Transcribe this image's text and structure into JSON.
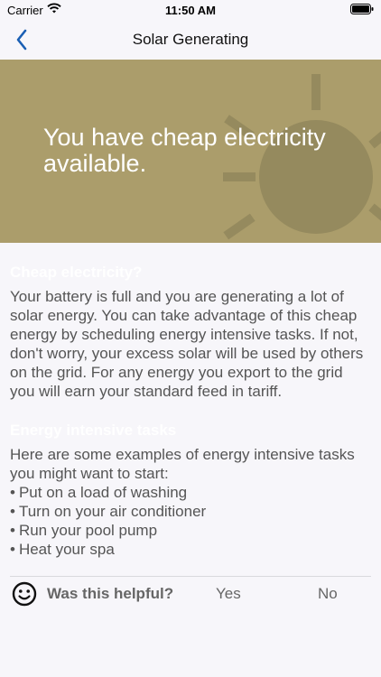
{
  "status_bar": {
    "carrier": "Carrier",
    "time": "11:50 AM"
  },
  "nav": {
    "title": "Solar Generating",
    "accent_color": "#1a5fb4"
  },
  "hero": {
    "headline": "You have cheap electricity available.",
    "background_color": "#ab9d6b"
  },
  "sections": [
    {
      "heading": "Cheap electricity?",
      "body": "Your battery is full and you are generating a lot of solar energy. You can take advantage of this cheap energy by scheduling energy intensive tasks. If not, don't worry, your excess solar will be used by others on the grid. For any energy you export to the grid you will earn your standard feed in tariff."
    },
    {
      "heading": "Energy intensive tasks",
      "body": "Here are some examples of energy intensive tasks you might want to start:",
      "items": [
        "Put on a load of washing",
        "Turn on your air conditioner",
        "Run your pool pump",
        "Heat your spa"
      ]
    }
  ],
  "feedback": {
    "question": "Was this helpful?",
    "yes_label": "Yes",
    "no_label": "No"
  }
}
